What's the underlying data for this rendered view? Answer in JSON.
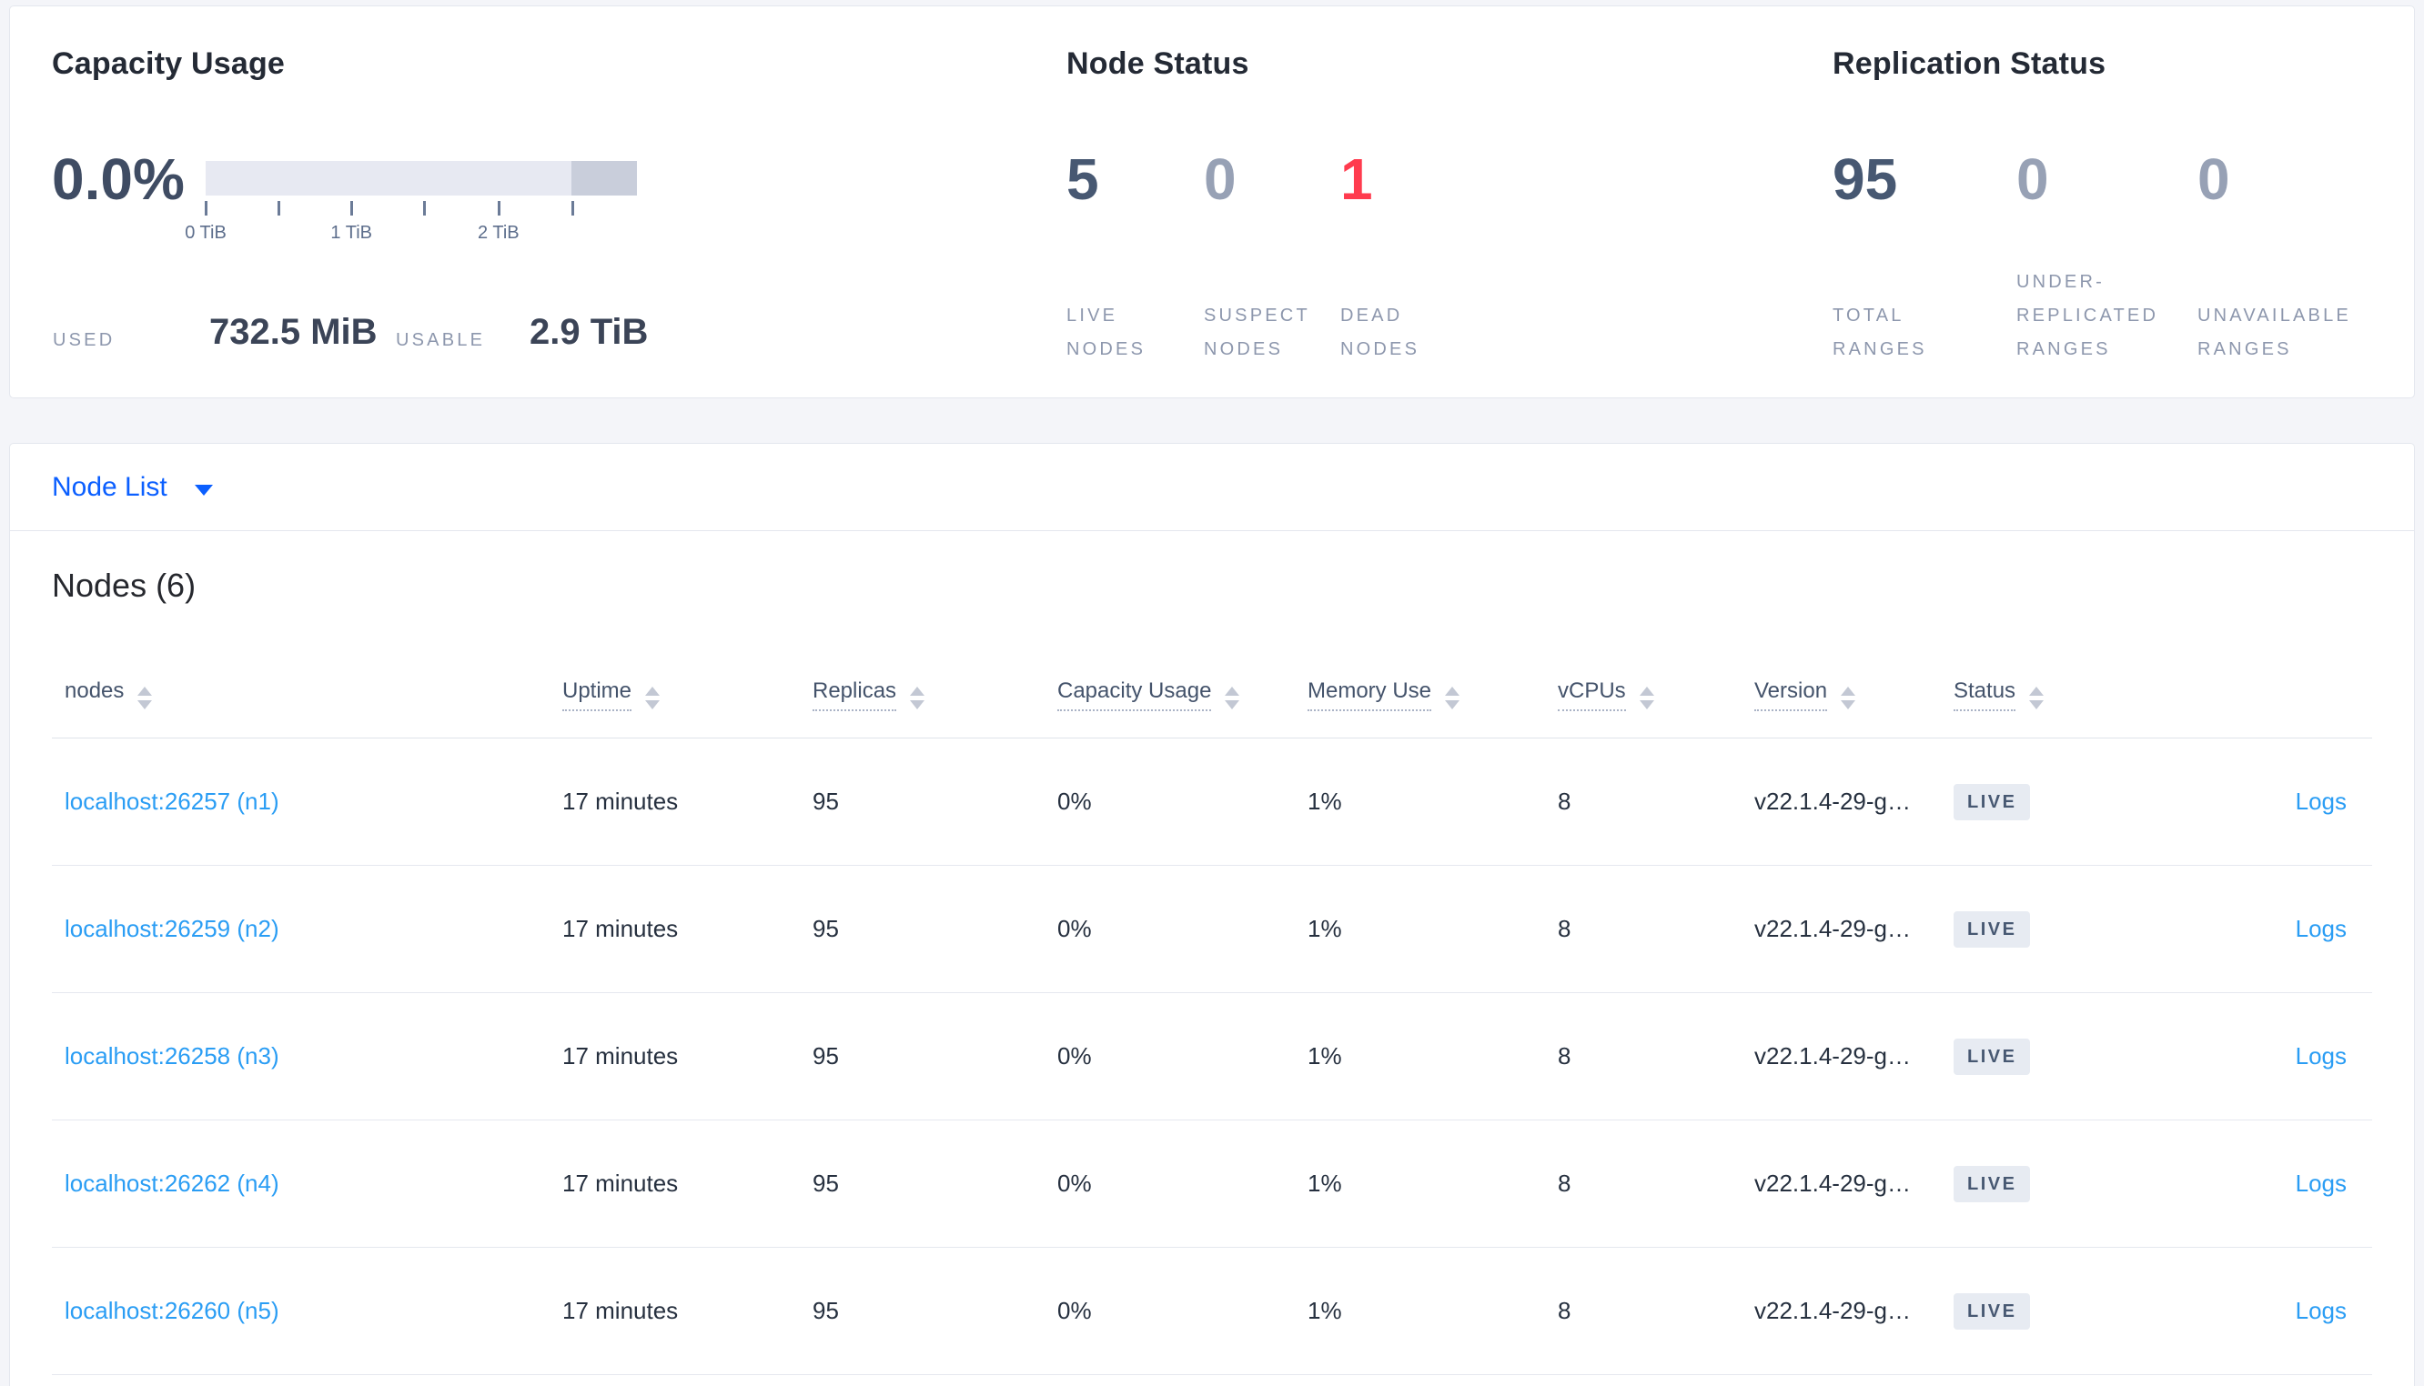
{
  "panels": {
    "capacity": {
      "title": "Capacity Usage",
      "percent": "0.0%",
      "bar": {
        "segments": [
          {
            "name": "capacity-usable-segment",
            "color": "#e7e9f2",
            "width_pct": 84.8
          },
          {
            "name": "capacity-reserved-segment",
            "color": "#c9cedb",
            "width_pct": 15.2
          }
        ],
        "ticks_pct": [
          0,
          16.9,
          33.8,
          50.6,
          67.9,
          85
        ],
        "tick_labels": [
          {
            "text": "0 TiB",
            "pct": 0
          },
          {
            "text": "1 TiB",
            "pct": 33.8
          },
          {
            "text": "2 TiB",
            "pct": 67.9
          }
        ]
      },
      "used_label": "USED",
      "used_value": "732.5 MiB",
      "usable_label": "USABLE",
      "usable_value": "2.9 TiB"
    },
    "node_status": {
      "title": "Node Status",
      "metrics": [
        {
          "value": "5",
          "color": "#475872",
          "lines": [
            "LIVE",
            "NODES"
          ]
        },
        {
          "value": "0",
          "color": "#97a1b5",
          "lines": [
            "SUSPECT",
            "NODES"
          ]
        },
        {
          "value": "1",
          "color": "#ff3b4e",
          "lines": [
            "DEAD",
            "NODES"
          ]
        }
      ]
    },
    "replication_status": {
      "title": "Replication Status",
      "metrics": [
        {
          "value": "95",
          "color": "#475872",
          "lines": [
            "TOTAL",
            "RANGES"
          ]
        },
        {
          "value": "0",
          "color": "#97a1b5",
          "lines": [
            "UNDER-",
            "REPLICATED",
            "RANGES"
          ]
        },
        {
          "value": "0",
          "color": "#97a1b5",
          "lines": [
            "UNAVAILABLE",
            "RANGES"
          ]
        }
      ]
    }
  },
  "view_selector": {
    "label": "Node List"
  },
  "nodes_table": {
    "title": "Nodes (6)",
    "columns": [
      {
        "label": "nodes",
        "dotted": false
      },
      {
        "label": "Uptime",
        "dotted": true
      },
      {
        "label": "Replicas",
        "dotted": true
      },
      {
        "label": "Capacity Usage",
        "dotted": true
      },
      {
        "label": "Memory Use",
        "dotted": true
      },
      {
        "label": "vCPUs",
        "dotted": true
      },
      {
        "label": "Version",
        "dotted": true
      },
      {
        "label": "Status",
        "dotted": true
      },
      {
        "label": "",
        "dotted": false
      }
    ],
    "logs_label": "Logs",
    "rows": [
      {
        "address": "localhost:26257 (n1)",
        "uptime": "17 minutes",
        "replicas": "95",
        "capacity": "0%",
        "memory": "1%",
        "vcpus": "8",
        "version": "v22.1.4-29-g…",
        "status": "LIVE"
      },
      {
        "address": "localhost:26259 (n2)",
        "uptime": "17 minutes",
        "replicas": "95",
        "capacity": "0%",
        "memory": "1%",
        "vcpus": "8",
        "version": "v22.1.4-29-g…",
        "status": "LIVE"
      },
      {
        "address": "localhost:26258 (n3)",
        "uptime": "17 minutes",
        "replicas": "95",
        "capacity": "0%",
        "memory": "1%",
        "vcpus": "8",
        "version": "v22.1.4-29-g…",
        "status": "LIVE"
      },
      {
        "address": "localhost:26262 (n4)",
        "uptime": "17 minutes",
        "replicas": "95",
        "capacity": "0%",
        "memory": "1%",
        "vcpus": "8",
        "version": "v22.1.4-29-g…",
        "status": "LIVE"
      },
      {
        "address": "localhost:26260 (n5)",
        "uptime": "17 minutes",
        "replicas": "95",
        "capacity": "0%",
        "memory": "1%",
        "vcpus": "8",
        "version": "v22.1.4-29-g…",
        "status": "LIVE"
      }
    ]
  }
}
